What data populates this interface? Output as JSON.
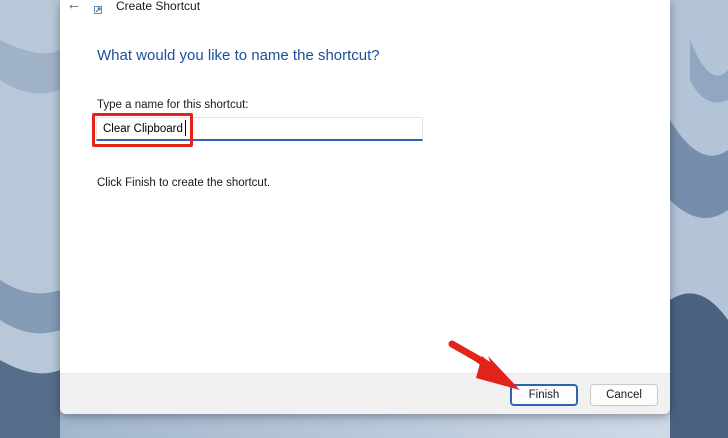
{
  "window": {
    "title": "Create Shortcut",
    "back_icon": "←"
  },
  "main": {
    "heading": "What would you like to name the shortcut?",
    "name_label": "Type a name for this shortcut:",
    "name_value": "Clear Clipboard",
    "info": "Click Finish to create the shortcut."
  },
  "footer": {
    "finish_label": "Finish",
    "cancel_label": "Cancel"
  },
  "annotations": {
    "highlight_color": "#e2231a",
    "arrow_color": "#e2231a"
  }
}
